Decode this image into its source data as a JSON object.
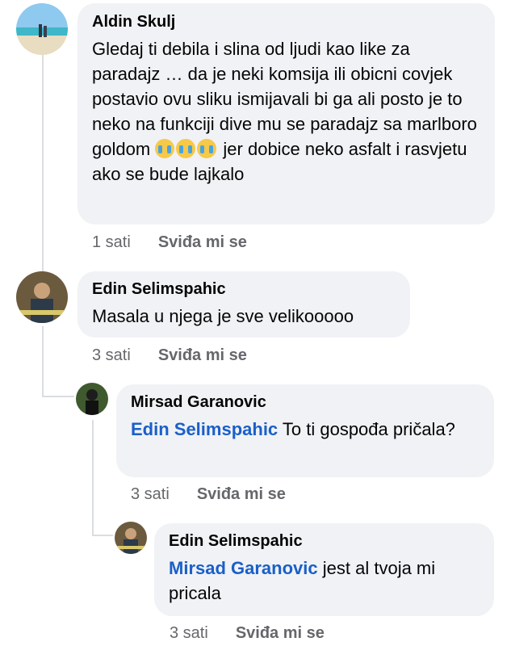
{
  "comments": [
    {
      "author": "Aldin Skulj",
      "text_before": "Gledaj ti debila i slina od ljudi kao like za paradajz … da je neki komsija ili obicni covjek postavio ovu sliku ismijavali bi ga ali posto je to neko na funkciji dive mu se paradajz sa marlboro goldom",
      "emoji_name": "loudly-crying-face",
      "text_after": "jer dobice neko asfalt i rasvjetu ako se bude lajkalo",
      "time": "1 sati",
      "like_label": "Sviđa mi se"
    },
    {
      "author": "Edin Selimspahic",
      "text": "Masala u njega je sve velikooooo",
      "time": "3 sati",
      "like_label": "Sviđa mi se"
    },
    {
      "author": "Mirsad Garanovic",
      "mention": "Edin Selimspahic",
      "text": "To ti gospođa pričala?",
      "time": "3 sati",
      "like_label": "Sviđa mi se"
    },
    {
      "author": "Edin Selimspahic",
      "mention": "Mirsad Garanovic",
      "text": "jest al tvoja mi pricala",
      "time": "3 sati",
      "like_label": "Sviđa mi se"
    }
  ],
  "colors": {
    "bubble": "#f0f2f5",
    "mention": "#1a5fc8",
    "meta": "#65676b",
    "thread_line": "#dadde1"
  }
}
